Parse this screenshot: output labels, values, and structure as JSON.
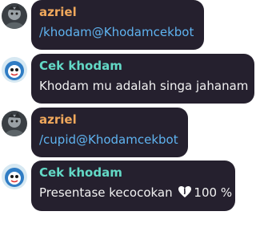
{
  "messages": [
    {
      "sender": "azriel",
      "sender_color": "#f0a85c",
      "avatar": "user-avatar",
      "text": "/khodam@Khodamcekbot",
      "is_command": true
    },
    {
      "sender": "Cek khodam",
      "sender_color": "#63d9c6",
      "avatar": "bot-avatar",
      "text": "Khodam mu adalah singa jahanam",
      "is_command": false
    },
    {
      "sender": "azriel",
      "sender_color": "#f0a85c",
      "avatar": "user-avatar",
      "text": "/cupid@Khodamcekbot",
      "is_command": true
    },
    {
      "sender": "Cek khodam",
      "sender_color": "#63d9c6",
      "avatar": "bot-avatar",
      "text_before": "Presentase kecocokan",
      "icon": "heart-icon",
      "text_after": "100 %",
      "is_command": false
    }
  ]
}
